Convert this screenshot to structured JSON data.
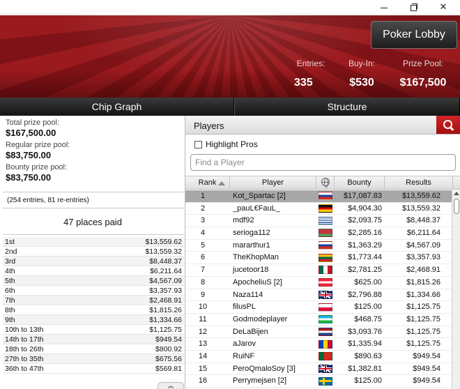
{
  "window": {
    "minimize_glyph": "",
    "close_glyph": "✕"
  },
  "header": {
    "lobby_button": "Poker Lobby",
    "entries_label": "Entries:",
    "entries_value": "335",
    "buyin_label": "Buy-In:",
    "buyin_value": "$530",
    "prize_label": "Prize Pool:",
    "prize_value": "$167,500"
  },
  "tabs": {
    "chip_graph": "Chip Graph",
    "structure": "Structure"
  },
  "prize_info": {
    "total_label": "Total prize pool:",
    "total_value": "$167,500.00",
    "regular_label": "Regular prize pool:",
    "regular_value": "$83,750.00",
    "bounty_label": "Bounty prize pool:",
    "bounty_value": "$83,750.00",
    "entries_note": "(254 entries, 81 re-entries)",
    "places_paid": "47 places paid"
  },
  "payouts": [
    {
      "place": "1st",
      "amount": "$13,559.62"
    },
    {
      "place": "2nd",
      "amount": "$13,559.32"
    },
    {
      "place": "3rd",
      "amount": "$8,448.37"
    },
    {
      "place": "4th",
      "amount": "$6,211.64"
    },
    {
      "place": "5th",
      "amount": "$4,567.09"
    },
    {
      "place": "6th",
      "amount": "$3,357.93"
    },
    {
      "place": "7th",
      "amount": "$2,468.91"
    },
    {
      "place": "8th",
      "amount": "$1,815.26"
    },
    {
      "place": "9th",
      "amount": "$1,334.66"
    },
    {
      "place": "10th to 13th",
      "amount": "$1,125.75"
    },
    {
      "place": "14th to 17th",
      "amount": "$949.54"
    },
    {
      "place": "18th to 26th",
      "amount": "$800.92"
    },
    {
      "place": "27th to 35th",
      "amount": "$675.56"
    },
    {
      "place": "36th to 47th",
      "amount": "$569.81"
    }
  ],
  "players_panel": {
    "title": "Players",
    "highlight_label": "Highlight Pros",
    "search_placeholder": "Find a Player",
    "columns": {
      "rank": "Rank",
      "player": "Player",
      "bounty": "Bounty",
      "results": "Results"
    },
    "rows": [
      {
        "rank": "1",
        "player": "Kot_Spartac [2]",
        "flag": "russia",
        "bounty": "$17,087.83",
        "result": "$13,559.62"
      },
      {
        "rank": "2",
        "player": "_pauL€FauL_",
        "flag": "germany",
        "bounty": "$4,904.30",
        "result": "$13,559.32"
      },
      {
        "rank": "3",
        "player": "mdf92",
        "flag": "uruguay",
        "bounty": "$2,093.75",
        "result": "$8,448.37"
      },
      {
        "rank": "4",
        "player": "serioga112",
        "flag": "belarus",
        "bounty": "$2,285.16",
        "result": "$6,211.64"
      },
      {
        "rank": "5",
        "player": "mararthur1",
        "flag": "russia",
        "bounty": "$1,363.29",
        "result": "$4,567.09"
      },
      {
        "rank": "6",
        "player": "TheKhopMan",
        "flag": "lithuania",
        "bounty": "$1,773.44",
        "result": "$3,357.93"
      },
      {
        "rank": "7",
        "player": "jucetoor18",
        "flag": "mexico",
        "bounty": "$2,781.25",
        "result": "$2,468.91"
      },
      {
        "rank": "8",
        "player": "ApocheliuS [2]",
        "flag": "austria",
        "bounty": "$625.00",
        "result": "$1,815.26"
      },
      {
        "rank": "9",
        "player": "Naza114",
        "flag": "uk",
        "bounty": "$2,796.88",
        "result": "$1,334.66"
      },
      {
        "rank": "10",
        "player": "filusPL",
        "flag": "poland",
        "bounty": "$125.00",
        "result": "$1,125.75"
      },
      {
        "rank": "11",
        "player": "Godmodeplayer",
        "flag": "uzbekistan",
        "bounty": "$468.75",
        "result": "$1,125.75"
      },
      {
        "rank": "12",
        "player": "DeLaBijen",
        "flag": "netherlands",
        "bounty": "$3,093.76",
        "result": "$1,125.75"
      },
      {
        "rank": "13",
        "player": "aJarov",
        "flag": "moldova",
        "bounty": "$1,335.94",
        "result": "$1,125.75"
      },
      {
        "rank": "14",
        "player": "RuiNF",
        "flag": "portugal",
        "bounty": "$890.63",
        "result": "$949.54"
      },
      {
        "rank": "15",
        "player": "PeroQmaloSoy [3]",
        "flag": "uk",
        "bounty": "$1,382.81",
        "result": "$949.54"
      },
      {
        "rank": "16",
        "player": "Perrymejsen [2]",
        "flag": "sweden",
        "bounty": "$125.00",
        "result": "$949.54"
      }
    ]
  },
  "colors": {
    "header_red": "#8e161b",
    "search_red": "#c01d20",
    "selected_row": "#a8a8a8"
  }
}
